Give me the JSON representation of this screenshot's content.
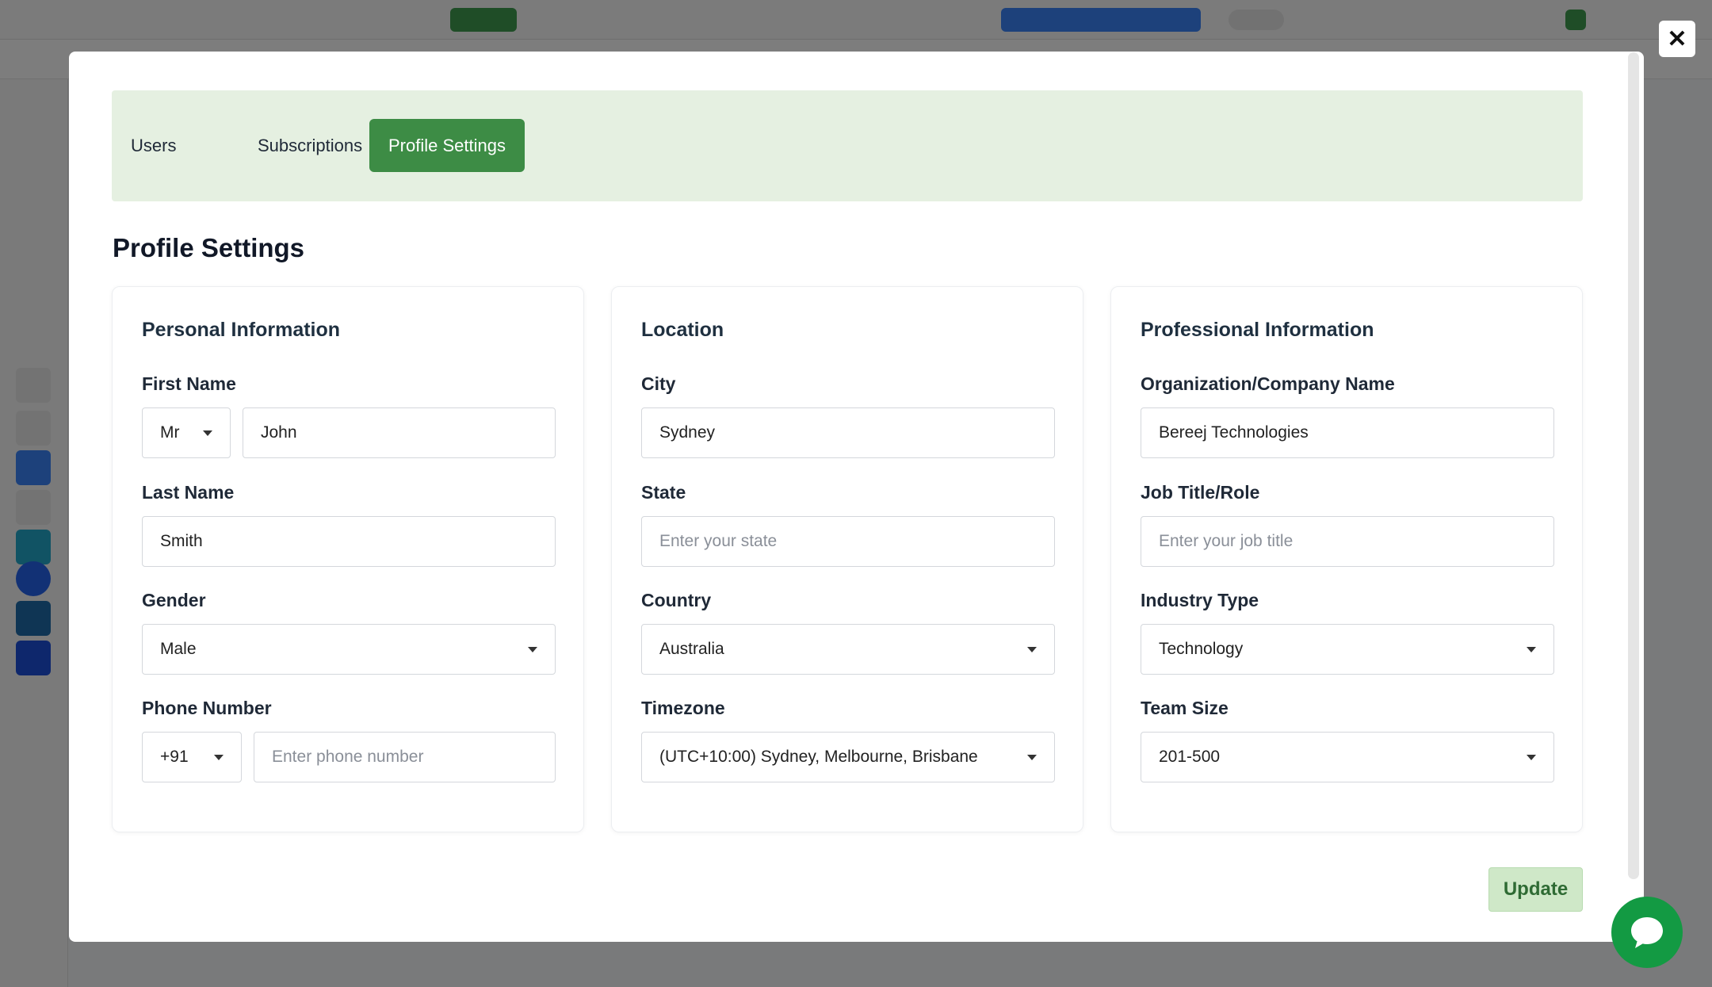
{
  "tabs": [
    {
      "label": "Users"
    },
    {
      "label": "Subscriptions"
    },
    {
      "label": "Profile Settings",
      "active": true
    }
  ],
  "page_title": "Profile Settings",
  "personal": {
    "title": "Personal Information",
    "first_name": {
      "label": "First Name",
      "salutation": "Mr",
      "value": "John"
    },
    "last_name": {
      "label": "Last Name",
      "value": "Smith"
    },
    "gender": {
      "label": "Gender",
      "value": "Male"
    },
    "phone": {
      "label": "Phone Number",
      "country_code": "+91",
      "placeholder": "Enter phone number"
    }
  },
  "location": {
    "title": "Location",
    "city": {
      "label": "City",
      "value": "Sydney"
    },
    "state": {
      "label": "State",
      "placeholder": "Enter your state"
    },
    "country": {
      "label": "Country",
      "value": "Australia"
    },
    "timezone": {
      "label": "Timezone",
      "value": "(UTC+10:00) Sydney, Melbourne, Brisbane"
    }
  },
  "professional": {
    "title": "Professional Information",
    "organization": {
      "label": "Organization/Company Name",
      "value": "Bereej Technologies"
    },
    "job_title": {
      "label": "Job Title/Role",
      "placeholder": "Enter your job title"
    },
    "industry": {
      "label": "Industry Type",
      "value": "Technology"
    },
    "team_size": {
      "label": "Team Size",
      "value": "201-500"
    }
  },
  "update_label": "Update",
  "close_glyph": "✕",
  "colors": {
    "accent": "#3d8c45",
    "tabs_bg": "#e5f0e1",
    "update_bg": "#cfe8c8",
    "chat_fab": "#139a43"
  },
  "icons": {
    "close": "close-icon",
    "chat": "chat-bubble-icon",
    "dropdown": "chevron-down-icon"
  }
}
